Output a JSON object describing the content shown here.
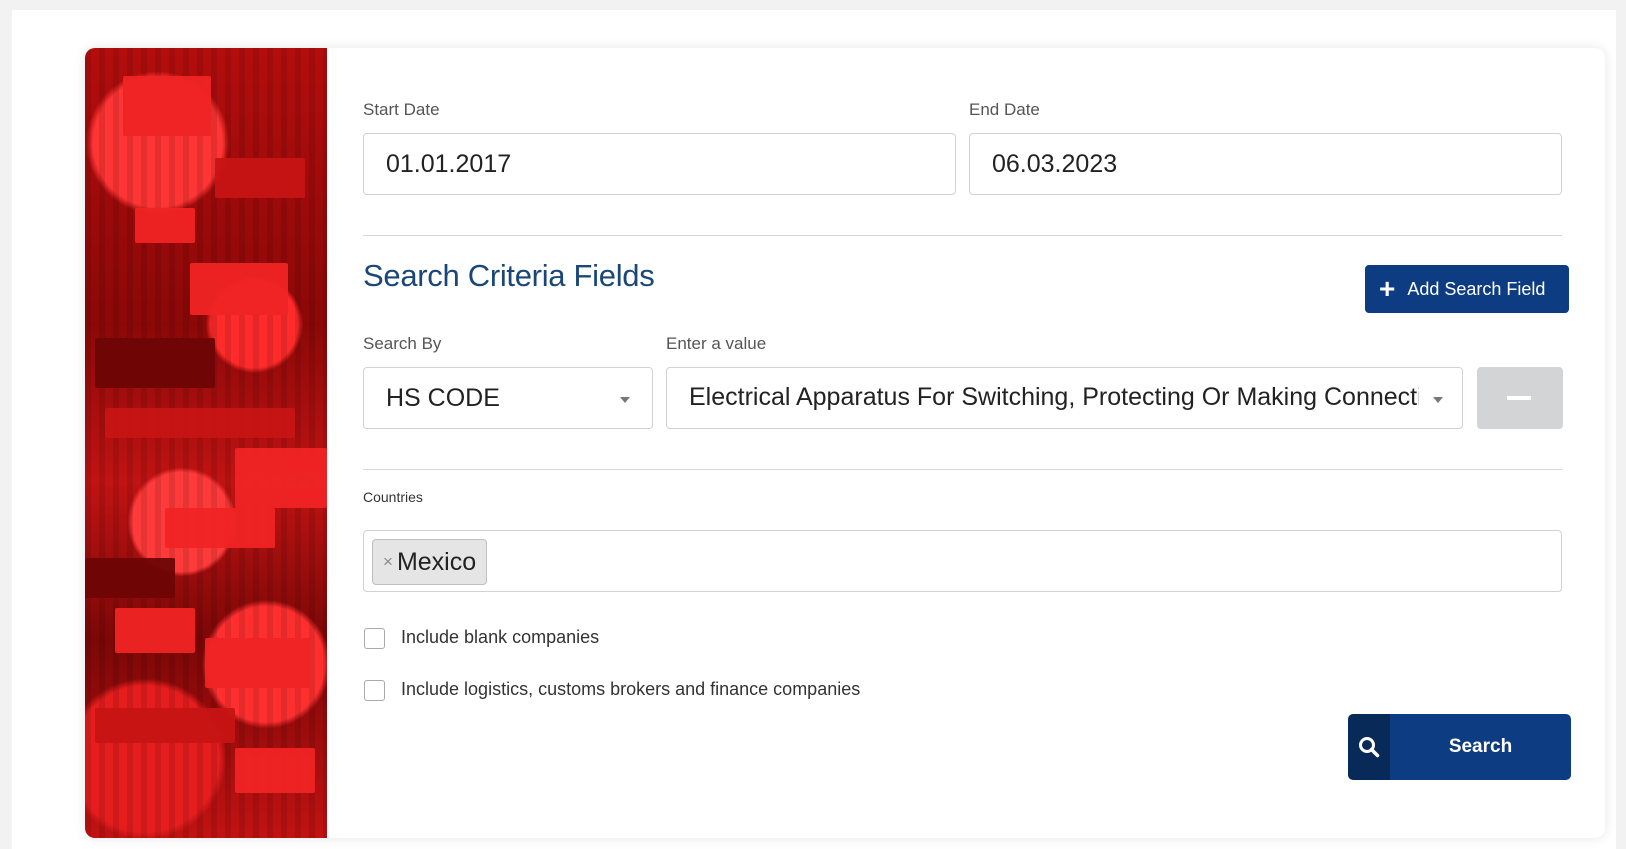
{
  "dates": {
    "start_label": "Start Date",
    "start_value": "01.01.2017",
    "end_label": "End Date",
    "end_value": "06.03.2023"
  },
  "criteria": {
    "heading": "Search Criteria Fields",
    "add_button_label": "Add Search Field",
    "search_by_label": "Search By",
    "search_by_value": "HS CODE",
    "value_label": "Enter a value",
    "value_text": "Electrical Apparatus For Switching, Protecting Or Making Connections To ..."
  },
  "countries": {
    "label": "Countries",
    "tags": [
      "Mexico"
    ],
    "tag_remove_glyph": "×"
  },
  "options": {
    "include_blank": {
      "label": "Include blank companies",
      "checked": false
    },
    "include_logistics": {
      "label": "Include logistics, customs brokers and finance companies",
      "checked": false
    }
  },
  "search_button": {
    "label": "Search",
    "icon": "search-icon"
  },
  "colors": {
    "primary": "#0d3c82",
    "primary_dark": "#082a58",
    "heading": "#1a4678",
    "side_image": "#c11313",
    "remove_button": "#d3d4d5"
  },
  "icons": {
    "add": "plus-icon",
    "remove": "minus-icon",
    "dropdown": "chevron-down-icon"
  }
}
